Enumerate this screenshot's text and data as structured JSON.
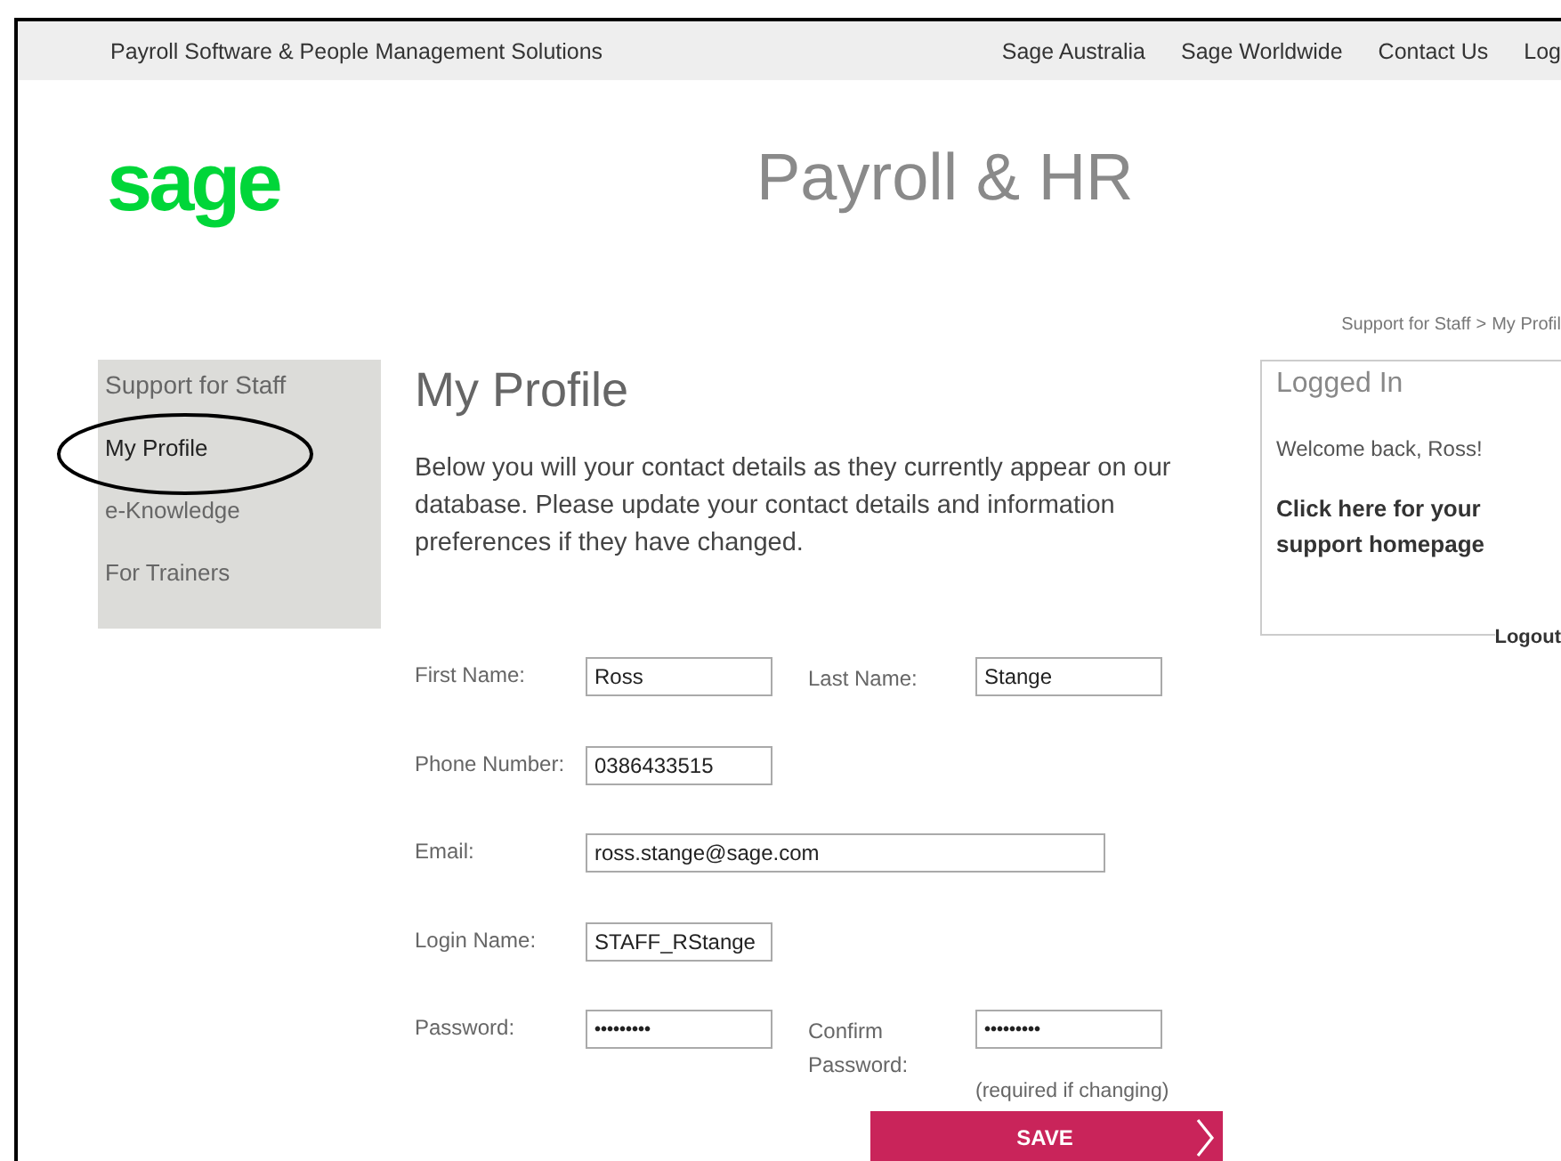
{
  "top_bar": {
    "tagline": "Payroll Software & People Management Solutions",
    "links": [
      "Sage Australia",
      "Sage Worldwide",
      "Contact Us",
      "Log"
    ]
  },
  "header": {
    "logo": "sage",
    "title": "Payroll & HR"
  },
  "breadcrumb": [
    "Support for Staff",
    ">",
    "My Profil"
  ],
  "sidebar": {
    "heading": "Support for Staff",
    "items": [
      {
        "label": "My Profile",
        "selected": true,
        "circled": true
      },
      {
        "label": "e-Knowledge",
        "selected": false,
        "circled": false
      },
      {
        "label": "For Trainers",
        "selected": false,
        "circled": false
      }
    ]
  },
  "main": {
    "heading": "My Profile",
    "intro": "Below you will your contact details as they currently appear on our database. Please update your contact details and information preferences if they have changed.",
    "rows": [
      {
        "fields": [
          {
            "kind": "text",
            "label": "First Name:",
            "value": "Ross"
          },
          {
            "kind": "text",
            "label": "Last Name:",
            "value": "Stange"
          }
        ]
      },
      {
        "fields": [
          {
            "kind": "text",
            "label": "Phone Number:",
            "value": "0386433515"
          }
        ]
      },
      {
        "fields": [
          {
            "kind": "email",
            "label": "Email:",
            "value": "ross.stange@sage.com"
          }
        ]
      },
      {
        "fields": [
          {
            "kind": "text",
            "label": "Login Name:",
            "value": "STAFF_RStange"
          }
        ]
      },
      {
        "fields": [
          {
            "kind": "password",
            "label": "Password:",
            "value": "•••••••••"
          },
          {
            "kind": "password",
            "label": "Confirm Password:",
            "value": "•••••••••"
          }
        ]
      }
    ],
    "note": "(required if changing)",
    "save_button": "SAVE"
  },
  "login_panel": {
    "title": "Logged In",
    "welcome": "Welcome back, Ross!",
    "link": "Click here for your support homepage",
    "logout": "Logout"
  }
}
